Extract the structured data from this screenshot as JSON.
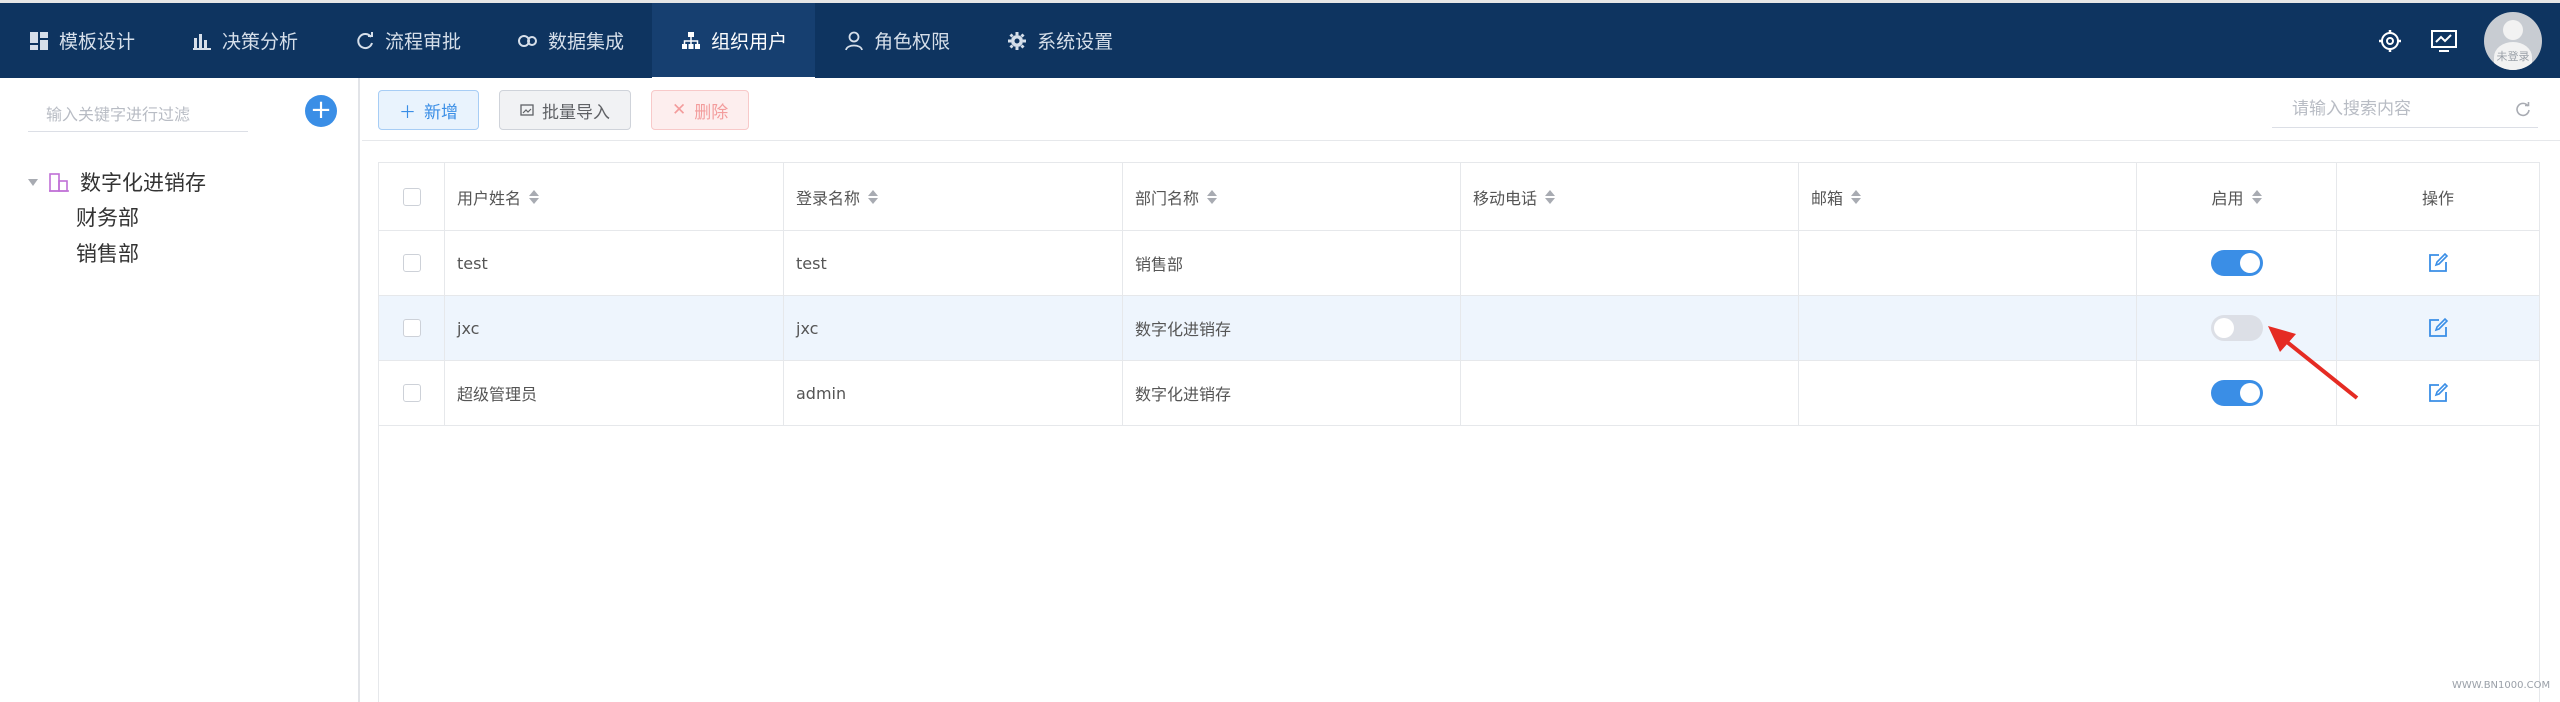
{
  "nav": {
    "items": [
      {
        "label": "模板设计",
        "icon": "dashboard-icon"
      },
      {
        "label": "决策分析",
        "icon": "bar-chart-icon"
      },
      {
        "label": "流程审批",
        "icon": "refresh-cycle-icon"
      },
      {
        "label": "数据集成",
        "icon": "link-icon"
      },
      {
        "label": "组织用户",
        "icon": "org-chart-icon",
        "active": true
      },
      {
        "label": "角色权限",
        "icon": "user-icon"
      },
      {
        "label": "系统设置",
        "icon": "gear-icon"
      }
    ],
    "avatar_tag": "未登录"
  },
  "sidebar": {
    "search_placeholder": "输入关键字进行过滤",
    "add_symbol": "+",
    "tree_root": "数字化进销存",
    "tree_children": [
      "财务部",
      "销售部"
    ]
  },
  "toolbar": {
    "add_label": "新增",
    "import_label": "批量导入",
    "delete_label": "删除",
    "search_placeholder": "请输入搜索内容"
  },
  "table": {
    "headers": [
      "用户姓名",
      "登录名称",
      "部门名称",
      "移动电话",
      "邮箱",
      "启用",
      "操作"
    ],
    "rows": [
      {
        "name": "test",
        "login": "test",
        "dept": "销售部",
        "phone": "",
        "email": "",
        "enabled": true
      },
      {
        "name": "jxc",
        "login": "jxc",
        "dept": "数字化进销存",
        "phone": "",
        "email": "",
        "enabled": false
      },
      {
        "name": "超级管理员",
        "login": "admin",
        "dept": "数字化进销存",
        "phone": "",
        "email": "",
        "enabled": true
      }
    ]
  },
  "colors": {
    "topbar": "#0e3460",
    "primary": "#3a8ee6",
    "annotation_arrow": "#e52b23"
  },
  "watermark": "WWW.BN1000.COM"
}
